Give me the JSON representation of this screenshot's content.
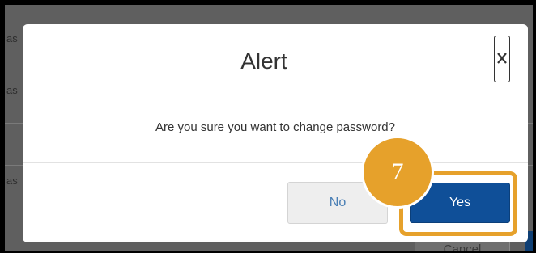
{
  "background": {
    "edge_texts": [
      "as",
      "as",
      "as"
    ],
    "cancel_label": "Cancel"
  },
  "dialog": {
    "title": "Alert",
    "close_icon": "close-icon",
    "message": "Are you sure you want to change password?",
    "buttons": {
      "no_label": "No",
      "yes_label": "Yes"
    }
  },
  "annotation": {
    "step_number": "7",
    "color": "#e6a12b"
  },
  "colors": {
    "primary": "#0f4f98",
    "secondary_text": "#4a7fb5",
    "overlay": "#5f5f5f"
  }
}
